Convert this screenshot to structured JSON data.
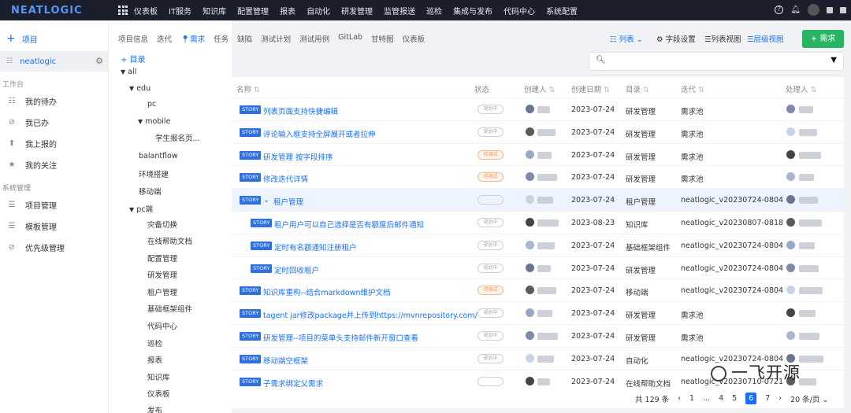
{
  "topbar": {
    "logo": "NEATLOGIC",
    "nav": [
      "仪表板",
      "IT服务",
      "知识库",
      "配置管理",
      "报表",
      "自动化",
      "研发管理",
      "监管报送",
      "巡检",
      "集成与发布",
      "代码中心",
      "系统配置"
    ]
  },
  "sidebar": {
    "project_label": "项目",
    "current_project": "neatlogic",
    "section_workbench": "工作台",
    "workbench_items": [
      {
        "label": "我的待办",
        "icon": "grid-icon"
      },
      {
        "label": "我已办",
        "icon": "check-circle-icon"
      },
      {
        "label": "我上报的",
        "icon": "upload-icon"
      },
      {
        "label": "我的关注",
        "icon": "star-icon"
      }
    ],
    "section_system": "系统管理",
    "system_items": [
      {
        "label": "项目管理",
        "icon": "list-icon"
      },
      {
        "label": "模板管理",
        "icon": "template-icon"
      },
      {
        "label": "优先级管理",
        "icon": "check-circle-icon"
      }
    ]
  },
  "tabs": [
    "项目信息",
    "迭代",
    "需求",
    "任务",
    "缺陷",
    "测试计划",
    "测试用例",
    "GitLab",
    "甘特图",
    "仪表板"
  ],
  "active_tab": "需求",
  "tree": {
    "add_label": "+ 目录",
    "nodes": [
      "all",
      "edu",
      "pc",
      "mobile",
      "学生报名页...",
      "balantflow",
      "环境搭建",
      "移动端",
      "pc端",
      "灾备切换",
      "在线帮助文档",
      "配置管理",
      "研发管理",
      "租户管理",
      "基础框架组件",
      "代码中心",
      "巡检",
      "报表",
      "知识库",
      "仪表板",
      "发布"
    ]
  },
  "toolbar": {
    "list": "列表",
    "field_settings": "字段设置",
    "list_view": "列表视图",
    "level_view": "层级视图",
    "new_request": "+ 需求"
  },
  "search": {
    "placeholder": ""
  },
  "table": {
    "columns": [
      "名称",
      "状态",
      "创建人",
      "创建日期",
      "目录",
      "迭代",
      "处理人"
    ],
    "rows": [
      {
        "tag": "STORY",
        "title": "列表页面支持快捷编辑",
        "status": "规划中",
        "status_color": "gray",
        "date": "2023-07-24",
        "catalog": "研发管理",
        "iteration": "需求池",
        "indent": 0
      },
      {
        "tag": "STORY",
        "title": "评论输入框支持全屏展开或者拉伸",
        "status": "规划中",
        "status_color": "gray",
        "date": "2023-07-24",
        "catalog": "研发管理",
        "iteration": "需求池",
        "indent": 0
      },
      {
        "tag": "STORY",
        "title": "研发管理 按字段排序",
        "status": "待测试",
        "status_color": "orange",
        "date": "2023-07-24",
        "catalog": "研发管理",
        "iteration": "需求池",
        "indent": 0
      },
      {
        "tag": "STORY",
        "title": "修改迭代详情",
        "status": "待测试",
        "status_color": "orange",
        "date": "2023-07-24",
        "catalog": "研发管理",
        "iteration": "需求池",
        "indent": 0
      },
      {
        "tag": "STORY",
        "title": "租户管理",
        "status": "",
        "status_color": "gray",
        "date": "2023-07-24",
        "catalog": "租户管理",
        "iteration": "neatlogic_v20230724-0804",
        "indent": 0,
        "expand": true
      },
      {
        "tag": "STORY",
        "title": "租户用户可以自己选择是否有额度后邮件通知",
        "status": "规划中",
        "status_color": "gray",
        "date": "2023-08-23",
        "catalog": "知识库",
        "iteration": "neatlogic_v20230807-0818",
        "indent": 1
      },
      {
        "tag": "STORY",
        "title": "定时有名额通知注册租户",
        "status": "规划中",
        "status_color": "gray",
        "date": "2023-07-24",
        "catalog": "基础框架组件",
        "iteration": "neatlogic_v20230724-0804",
        "indent": 1
      },
      {
        "tag": "STORY",
        "title": "定时回收租户",
        "status": "规划中",
        "status_color": "gray",
        "date": "2023-07-24",
        "catalog": "研发管理",
        "iteration": "neatlogic_v20230724-0804",
        "indent": 1
      },
      {
        "tag": "STORY",
        "title": "知识库重构--结合markdown维护文档",
        "status": "待测试",
        "status_color": "orange",
        "date": "2023-07-24",
        "catalog": "移动端",
        "iteration": "neatlogic_v20230724-0804",
        "indent": 0
      },
      {
        "tag": "STORY",
        "title": "tagent jar修改package并上传到https://mvnrepository.com/",
        "status": "规划中",
        "status_color": "gray",
        "date": "2023-07-24",
        "catalog": "研发管理",
        "iteration": "需求池",
        "indent": 0
      },
      {
        "tag": "STORY",
        "title": "研发管理--项目的菜单头支持邮件新开窗口查看",
        "status": "规划中",
        "status_color": "gray",
        "date": "2023-07-24",
        "catalog": "研发管理",
        "iteration": "需求池",
        "indent": 0
      },
      {
        "tag": "STORY",
        "title": "移动端空框架",
        "status": "规划中",
        "status_color": "gray",
        "date": "2023-07-24",
        "catalog": "自动化",
        "iteration": "neatlogic_v20230724-0804",
        "indent": 0
      },
      {
        "tag": "STORY",
        "title": "子需求绑定父需求",
        "status": "",
        "status_color": "gray",
        "date": "2023-07-24",
        "catalog": "在线帮助文档",
        "iteration": "neatlogic_v20230710-0721",
        "indent": 0
      }
    ]
  },
  "pager": {
    "total": "共 129 条",
    "pages": [
      "1",
      "...",
      "4",
      "5",
      "6",
      "7"
    ],
    "current": "6",
    "page_size": "20 条/页"
  },
  "watermark": "一飞开源"
}
